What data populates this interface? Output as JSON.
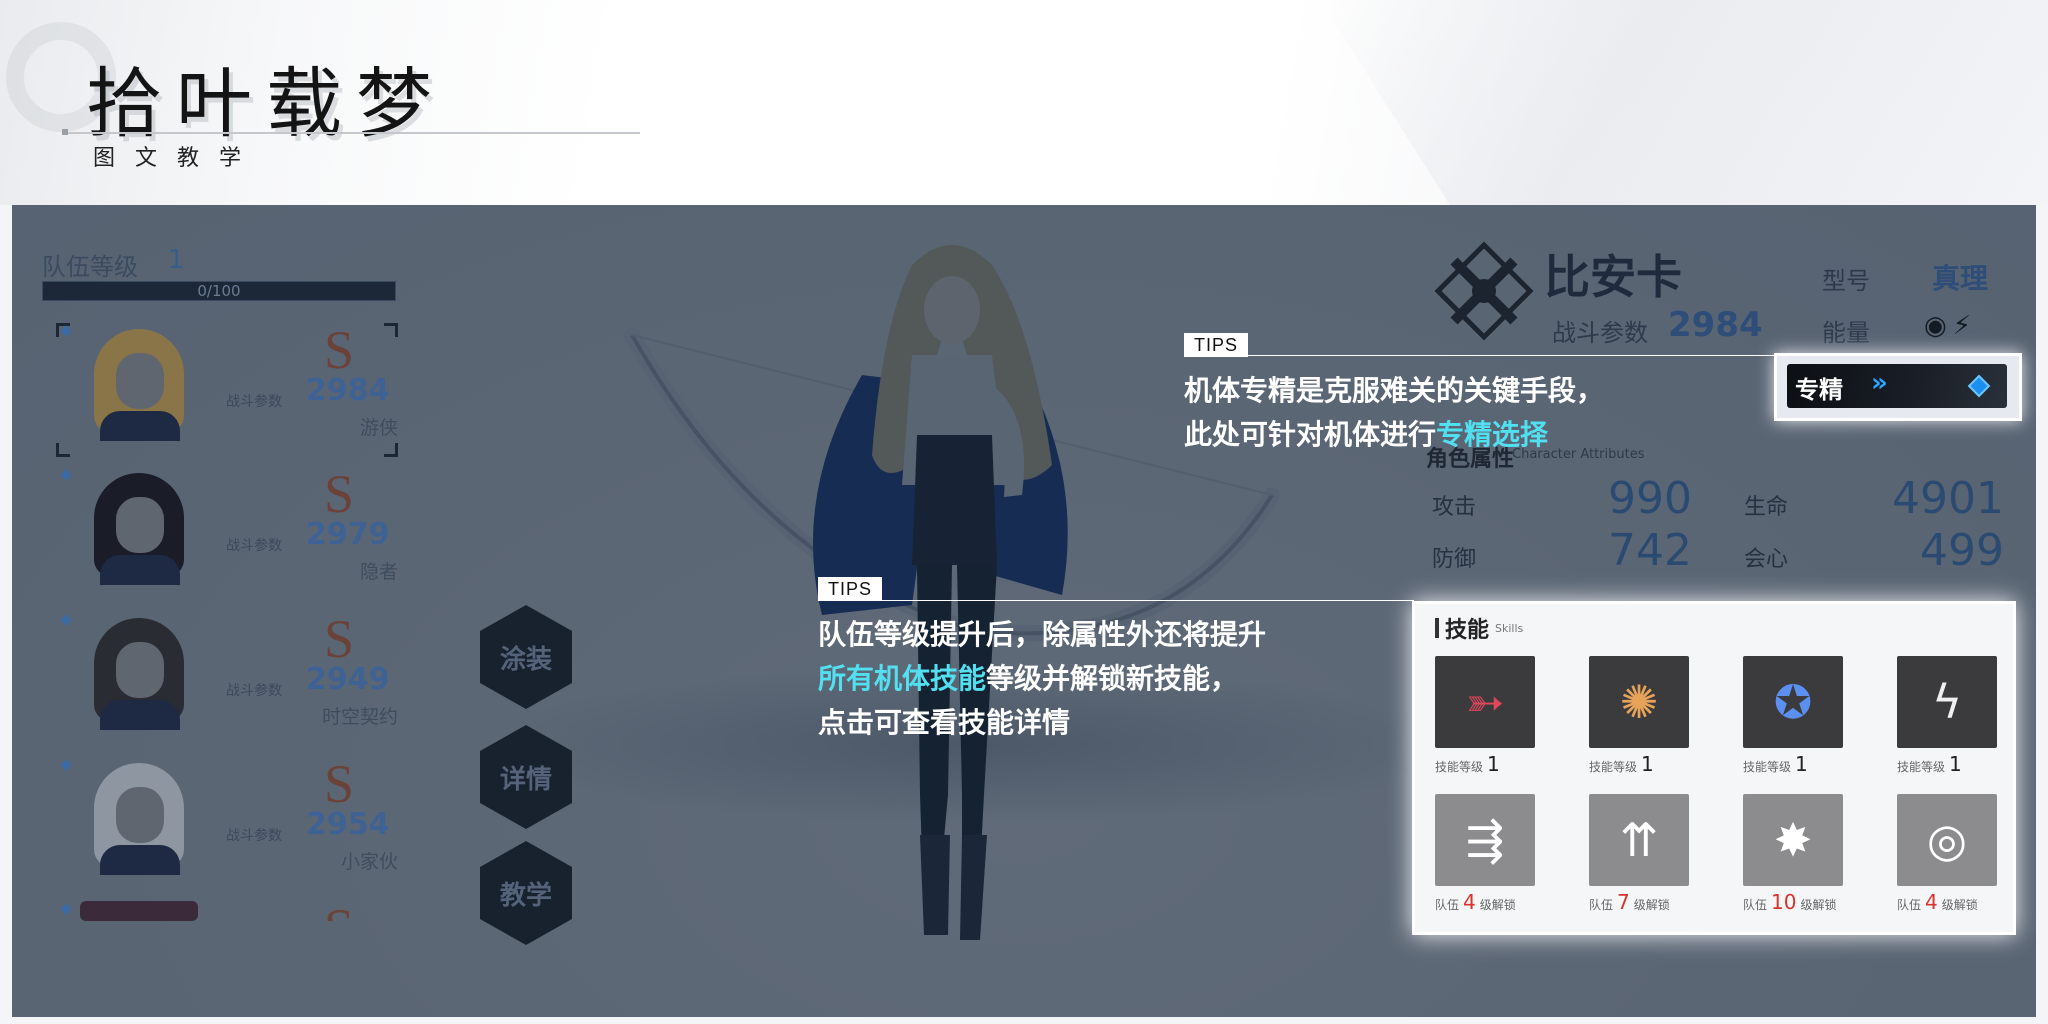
{
  "header": {
    "title": "拾叶载梦",
    "subtitle": "图文教学"
  },
  "team": {
    "label": "队伍等级",
    "level": "1",
    "xp_text": "0/100",
    "xp_progress": 0.0
  },
  "roster": [
    {
      "rank": "S",
      "cp_label": "战斗参数",
      "cp": "2984",
      "name": "游侠",
      "hair_color": "#8a7548"
    },
    {
      "rank": "S",
      "cp_label": "战斗参数",
      "cp": "2979",
      "name": "隐者",
      "hair_color": "#1a1c28"
    },
    {
      "rank": "S",
      "cp_label": "战斗参数",
      "cp": "2949",
      "name": "时空契约",
      "hair_color": "#2a2c34"
    },
    {
      "rank": "S",
      "cp_label": "战斗参数",
      "cp": "2954",
      "name": "小家伙",
      "hair_color": "#8e96a2"
    },
    {
      "rank": "S"
    }
  ],
  "side_buttons": [
    "涂装",
    "详情",
    "教学"
  ],
  "character": {
    "name": "比安卡",
    "cp_label": "战斗参数",
    "cp": "2984",
    "model_label": "型号",
    "model_value": "真理",
    "energy_label": "能量",
    "energy_icons": [
      "eye-slash-icon",
      "lightning-icon"
    ],
    "attributes_title": "角色属性",
    "attributes_title_en": "Character Attributes",
    "attributes": [
      {
        "label": "攻击",
        "value": "990"
      },
      {
        "label": "生命",
        "value": "4901"
      },
      {
        "label": "防御",
        "value": "742"
      },
      {
        "label": "会心",
        "value": "499"
      }
    ]
  },
  "tips": [
    {
      "tag": "TIPS",
      "line1": "机体专精是克服难关的关键手段，",
      "line2_prefix": "此处可针对机体进行",
      "line2_highlight": "专精选择"
    },
    {
      "tag": "TIPS",
      "line1": "队伍等级提升后，除属性外还将提升",
      "line2_highlight": "所有机体技能",
      "line2_suffix": "等级并解锁新技能，",
      "line3": "点击可查看技能详情"
    }
  ],
  "spec_button": {
    "label": "专精",
    "chevrons": "»"
  },
  "skills": {
    "title": "技能",
    "title_en": "Skills",
    "unlocked": [
      {
        "icon": "crossbow-arrow-icon",
        "caption": "技能等级",
        "level": "1",
        "bg": "#3b3b3d",
        "fg": "#e0475a"
      },
      {
        "icon": "fire-burst-icon",
        "caption": "技能等级",
        "level": "1",
        "bg": "#3b3b3d",
        "fg": "#e8a35a"
      },
      {
        "icon": "star-swirl-icon",
        "caption": "技能等级",
        "level": "1",
        "bg": "#3b3b3d",
        "fg": "#5b8ff0"
      },
      {
        "icon": "lightning-shards-icon",
        "caption": "技能等级",
        "level": "1",
        "bg": "#3b3b3d",
        "fg": "#f0f0f0"
      }
    ],
    "locked": [
      {
        "icon": "arrow-rain-icon",
        "prefix": "队伍",
        "level": "4",
        "suffix": "级解锁"
      },
      {
        "icon": "triple-arrow-ring-icon",
        "prefix": "队伍",
        "level": "7",
        "suffix": "级解锁"
      },
      {
        "icon": "star-explosion-icon",
        "prefix": "队伍",
        "level": "10",
        "suffix": "级解锁"
      },
      {
        "icon": "vortex-ring-icon",
        "prefix": "队伍",
        "level": "4",
        "suffix": "级解锁"
      }
    ]
  }
}
